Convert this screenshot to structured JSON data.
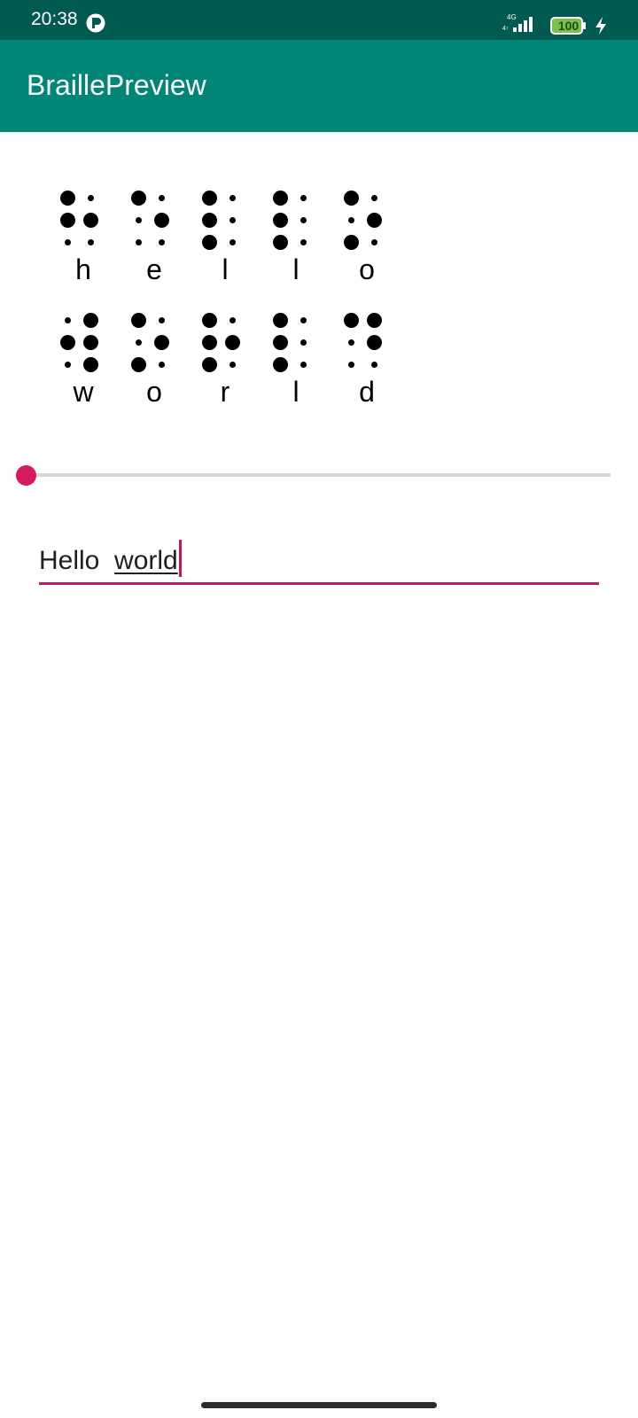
{
  "status_bar": {
    "time": "20:38",
    "network_type": "4G",
    "battery_level": "100",
    "charging": true,
    "icons": [
      "app-notification-icon",
      "signal-icon",
      "battery-icon",
      "charging-bolt-icon"
    ]
  },
  "app_bar": {
    "title": "BraillePreview",
    "color": "#008577"
  },
  "braille": {
    "rows": [
      [
        {
          "letter": "h",
          "dots": [
            1,
            2,
            5
          ]
        },
        {
          "letter": "e",
          "dots": [
            1,
            5
          ]
        },
        {
          "letter": "l",
          "dots": [
            1,
            2,
            3
          ]
        },
        {
          "letter": "l",
          "dots": [
            1,
            2,
            3
          ]
        },
        {
          "letter": "o",
          "dots": [
            1,
            3,
            5
          ]
        }
      ],
      [
        {
          "letter": "w",
          "dots": [
            2,
            4,
            5,
            6
          ]
        },
        {
          "letter": "o",
          "dots": [
            1,
            3,
            5
          ]
        },
        {
          "letter": "r",
          "dots": [
            1,
            2,
            3,
            5
          ]
        },
        {
          "letter": "l",
          "dots": [
            1,
            2,
            3
          ]
        },
        {
          "letter": "d",
          "dots": [
            1,
            4,
            5
          ]
        }
      ]
    ]
  },
  "slider": {
    "value": 0,
    "accent_color": "#d81b60"
  },
  "text_field": {
    "value": "Hello  world",
    "prefix": "Hello  ",
    "underlined_word": "world",
    "accent_color": "#c2185b"
  }
}
